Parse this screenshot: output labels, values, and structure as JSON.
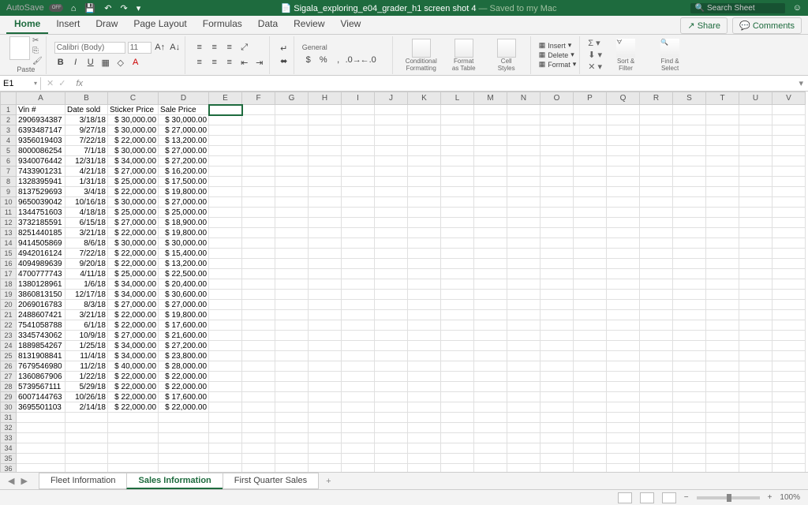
{
  "title": {
    "file": "Sigala_exploring_e04_grader_h1 screen shot 4",
    "saved": " — Saved to my Mac",
    "autosave": "AutoSave",
    "off": "OFF",
    "search": "Search Sheet"
  },
  "tabs": [
    "Home",
    "Insert",
    "Draw",
    "Page Layout",
    "Formulas",
    "Data",
    "Review",
    "View"
  ],
  "share": "Share",
  "comments": "Comments",
  "paste": "Paste",
  "font": {
    "name": "Calibri (Body)",
    "size": "11"
  },
  "numfmt": "General",
  "big": {
    "cf": "Conditional\nFormatting",
    "ft": "Format\nas Table",
    "cs": "Cell\nStyles",
    "ins": "Insert",
    "del": "Delete",
    "fmt": "Format",
    "sf": "Sort &\nFilter",
    "fs": "Find &\nSelect"
  },
  "namebox": "E1",
  "cols": [
    "A",
    "B",
    "C",
    "D",
    "E",
    "F",
    "G",
    "H",
    "I",
    "J",
    "K",
    "L",
    "M",
    "N",
    "O",
    "P",
    "Q",
    "R",
    "S",
    "T",
    "U",
    "V"
  ],
  "headers": {
    "a": "Vin #",
    "b": "Date sold",
    "c": "Sticker Price",
    "d": "Sale Price"
  },
  "rows": [
    {
      "a": "2906934387",
      "b": "3/18/18",
      "c": "$ 30,000.00",
      "d": "$ 30,000.00"
    },
    {
      "a": "6393487147",
      "b": "9/27/18",
      "c": "$ 30,000.00",
      "d": "$ 27,000.00"
    },
    {
      "a": "9356019403",
      "b": "7/22/18",
      "c": "$ 22,000.00",
      "d": "$ 13,200.00"
    },
    {
      "a": "8000086254",
      "b": "7/1/18",
      "c": "$ 30,000.00",
      "d": "$ 27,000.00"
    },
    {
      "a": "9340076442",
      "b": "12/31/18",
      "c": "$ 34,000.00",
      "d": "$ 27,200.00"
    },
    {
      "a": "7433901231",
      "b": "4/21/18",
      "c": "$ 27,000.00",
      "d": "$ 16,200.00"
    },
    {
      "a": "1328395941",
      "b": "1/31/18",
      "c": "$ 25,000.00",
      "d": "$ 17,500.00"
    },
    {
      "a": "8137529693",
      "b": "3/4/18",
      "c": "$ 22,000.00",
      "d": "$ 19,800.00"
    },
    {
      "a": "9650039042",
      "b": "10/16/18",
      "c": "$ 30,000.00",
      "d": "$ 27,000.00"
    },
    {
      "a": "1344751603",
      "b": "4/18/18",
      "c": "$ 25,000.00",
      "d": "$ 25,000.00"
    },
    {
      "a": "3732185591",
      "b": "6/15/18",
      "c": "$ 27,000.00",
      "d": "$ 18,900.00"
    },
    {
      "a": "8251440185",
      "b": "3/21/18",
      "c": "$ 22,000.00",
      "d": "$ 19,800.00"
    },
    {
      "a": "9414505869",
      "b": "8/6/18",
      "c": "$ 30,000.00",
      "d": "$ 30,000.00"
    },
    {
      "a": "4942016124",
      "b": "7/22/18",
      "c": "$ 22,000.00",
      "d": "$ 15,400.00"
    },
    {
      "a": "4094989639",
      "b": "9/20/18",
      "c": "$ 22,000.00",
      "d": "$ 13,200.00"
    },
    {
      "a": "4700777743",
      "b": "4/11/18",
      "c": "$ 25,000.00",
      "d": "$ 22,500.00"
    },
    {
      "a": "1380128961",
      "b": "1/6/18",
      "c": "$ 34,000.00",
      "d": "$ 20,400.00"
    },
    {
      "a": "3860813150",
      "b": "12/17/18",
      "c": "$ 34,000.00",
      "d": "$ 30,600.00"
    },
    {
      "a": "2069016783",
      "b": "8/3/18",
      "c": "$ 27,000.00",
      "d": "$ 27,000.00"
    },
    {
      "a": "2488607421",
      "b": "3/21/18",
      "c": "$ 22,000.00",
      "d": "$ 19,800.00"
    },
    {
      "a": "7541058788",
      "b": "6/1/18",
      "c": "$ 22,000.00",
      "d": "$ 17,600.00"
    },
    {
      "a": "3345743062",
      "b": "10/9/18",
      "c": "$ 27,000.00",
      "d": "$ 21,600.00"
    },
    {
      "a": "1889854267",
      "b": "1/25/18",
      "c": "$ 34,000.00",
      "d": "$ 27,200.00"
    },
    {
      "a": "8131908841",
      "b": "11/4/18",
      "c": "$ 34,000.00",
      "d": "$ 23,800.00"
    },
    {
      "a": "7679546980",
      "b": "11/2/18",
      "c": "$ 40,000.00",
      "d": "$ 28,000.00"
    },
    {
      "a": "1360867906",
      "b": "1/22/18",
      "c": "$ 22,000.00",
      "d": "$ 22,000.00"
    },
    {
      "a": "5739567111",
      "b": "5/29/18",
      "c": "$ 22,000.00",
      "d": "$ 22,000.00"
    },
    {
      "a": "6007144763",
      "b": "10/26/18",
      "c": "$ 22,000.00",
      "d": "$ 17,600.00"
    },
    {
      "a": "3695501103",
      "b": "2/14/18",
      "c": "$ 22,000.00",
      "d": "$ 22,000.00"
    }
  ],
  "sheets": [
    "Fleet Information",
    "Sales Information",
    "First Quarter Sales"
  ],
  "zoom": "100%"
}
